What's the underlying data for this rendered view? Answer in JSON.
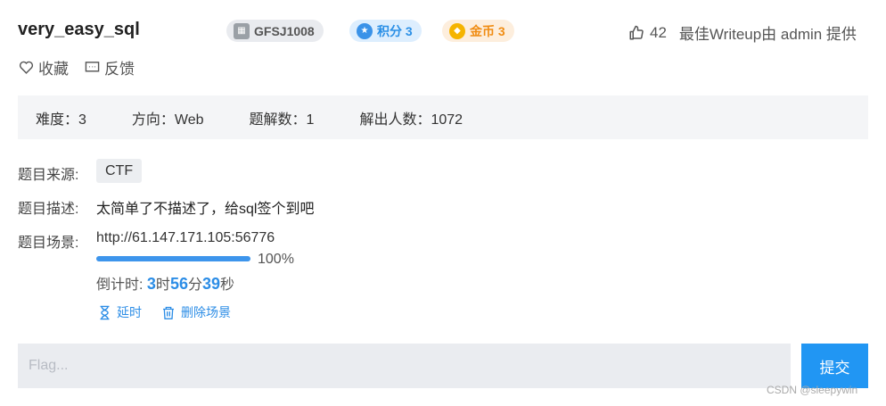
{
  "challenge": {
    "title": "very_easy_sql",
    "id_badge": "GFSJ1008",
    "score_badge": "积分 3",
    "coin_badge": "金币 3",
    "likes": "42",
    "writeup_credit": "最佳Writeup由 admin 提供"
  },
  "actions": {
    "favorite": "收藏",
    "feedback": "反馈"
  },
  "stats": {
    "difficulty": "难度：3",
    "direction": "方向：Web",
    "solve_count": "题解数：1",
    "solvers": "解出人数：1072"
  },
  "info": {
    "source_label": "题目来源:",
    "source_value": "CTF",
    "desc_label": "题目描述:",
    "desc_value": "太简单了不描述了，给sql签个到吧",
    "scene_label": "题目场景:",
    "scene_url": "http://61.147.171.105:56776",
    "progress_percent": 100,
    "progress_text": "100%",
    "countdown_prefix": "倒计时: ",
    "hours": "3",
    "hours_unit": "时",
    "minutes": "56",
    "minutes_unit": "分",
    "seconds": "39",
    "seconds_unit": "秒",
    "extend_label": "延时",
    "delete_label": "删除场景"
  },
  "flag": {
    "placeholder": "Flag...",
    "submit_label": "提交"
  },
  "watermark": "CSDN @sleepywin",
  "colors": {
    "accent": "#2196f3",
    "score": "#2a8fe6",
    "coin": "#f08c12"
  },
  "icons": {
    "like": "thumbs-up-icon",
    "favorite": "heart-icon",
    "feedback": "message-icon",
    "extend": "hourglass-icon",
    "delete": "trash-icon"
  }
}
